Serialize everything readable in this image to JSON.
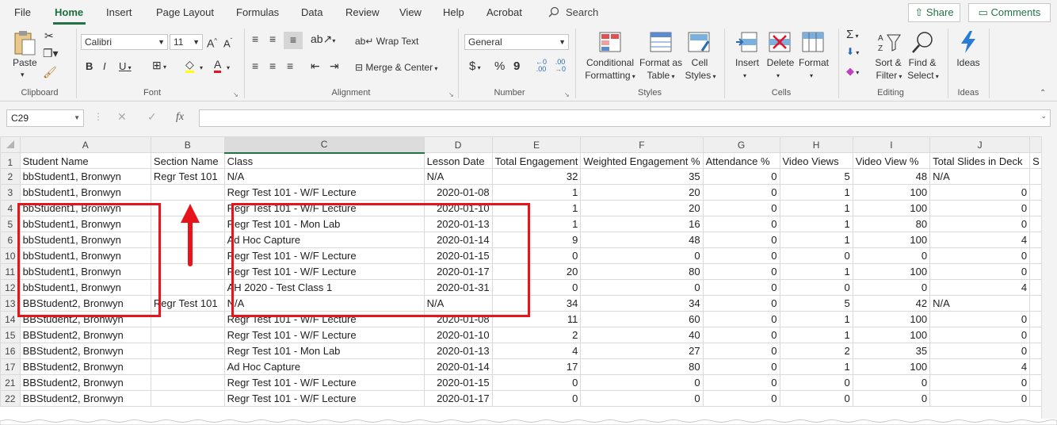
{
  "menu": {
    "tabs": [
      "File",
      "Home",
      "Insert",
      "Page Layout",
      "Formulas",
      "Data",
      "Review",
      "View",
      "Help",
      "Acrobat"
    ],
    "search": "Search",
    "share": "Share",
    "comments": "Comments"
  },
  "ribbon": {
    "clipboard": {
      "paste": "Paste",
      "label": "Clipboard"
    },
    "font": {
      "name": "Calibri",
      "size": "11",
      "label": "Font"
    },
    "alignment": {
      "wrap": "Wrap Text",
      "merge": "Merge & Center",
      "label": "Alignment"
    },
    "number": {
      "format": "General",
      "label": "Number"
    },
    "styles": {
      "cond1": "Conditional",
      "cond2": "Formatting",
      "fmt1": "Format as",
      "fmt2": "Table",
      "cell1": "Cell",
      "cell2": "Styles",
      "label": "Styles"
    },
    "cells": {
      "insert": "Insert",
      "delete": "Delete",
      "format": "Format",
      "label": "Cells"
    },
    "editing": {
      "sort1": "Sort &",
      "sort2": "Filter",
      "find1": "Find &",
      "find2": "Select",
      "label": "Editing"
    },
    "ideas": {
      "btn": "Ideas",
      "label": "Ideas"
    }
  },
  "formula_bar": {
    "name_box": "C29",
    "fx": "fx",
    "value": ""
  },
  "sheet": {
    "columns": [
      "A",
      "B",
      "C",
      "D",
      "E",
      "F",
      "G",
      "H",
      "I",
      "J",
      "S"
    ],
    "header_row": {
      "num": "1",
      "cells": [
        "Student Name",
        "Section Name",
        "Class",
        "Lesson Date",
        "Total Engagement",
        "Weighted Engagement %",
        "Attendance %",
        "Video Views",
        "Video View %",
        "Total Slides in Deck",
        "S"
      ]
    },
    "rows": [
      {
        "num": "2",
        "cells": [
          "bbStudent1, Bronwyn",
          "Regr Test 101",
          "N/A",
          "N/A",
          "32",
          "35",
          "0",
          "5",
          "48",
          "N/A"
        ]
      },
      {
        "num": "3",
        "cells": [
          "bbStudent1, Bronwyn",
          "",
          "Regr Test 101 - W/F Lecture",
          "2020-01-08",
          "1",
          "20",
          "0",
          "1",
          "100",
          "0"
        ]
      },
      {
        "num": "4",
        "cells": [
          "bbStudent1, Bronwyn",
          "",
          "Regr Test 101 - W/F Lecture",
          "2020-01-10",
          "1",
          "20",
          "0",
          "1",
          "100",
          "0"
        ]
      },
      {
        "num": "5",
        "cells": [
          "bbStudent1, Bronwyn",
          "",
          "Regr Test 101 - Mon Lab",
          "2020-01-13",
          "1",
          "16",
          "0",
          "1",
          "80",
          "0"
        ]
      },
      {
        "num": "6",
        "cells": [
          "bbStudent1, Bronwyn",
          "",
          "Ad Hoc Capture",
          "2020-01-14",
          "9",
          "48",
          "0",
          "1",
          "100",
          "4"
        ]
      },
      {
        "num": "10",
        "cells": [
          "bbStudent1, Bronwyn",
          "",
          "Regr Test 101 - W/F Lecture",
          "2020-01-15",
          "0",
          "0",
          "0",
          "0",
          "0",
          "0"
        ]
      },
      {
        "num": "11",
        "cells": [
          "bbStudent1, Bronwyn",
          "",
          "Regr Test 101 - W/F Lecture",
          "2020-01-17",
          "20",
          "80",
          "0",
          "1",
          "100",
          "0"
        ]
      },
      {
        "num": "12",
        "cells": [
          "bbStudent1, Bronwyn",
          "",
          "AH 2020 - Test Class 1",
          "2020-01-31",
          "0",
          "0",
          "0",
          "0",
          "0",
          "4"
        ]
      },
      {
        "num": "13",
        "cells": [
          "BBStudent2, Bronwyn",
          "Regr Test 101",
          "N/A",
          "N/A",
          "34",
          "34",
          "0",
          "5",
          "42",
          "N/A"
        ]
      },
      {
        "num": "14",
        "cells": [
          "BBStudent2, Bronwyn",
          "",
          "Regr Test 101 - W/F Lecture",
          "2020-01-08",
          "11",
          "60",
          "0",
          "1",
          "100",
          "0"
        ]
      },
      {
        "num": "15",
        "cells": [
          "BBStudent2, Bronwyn",
          "",
          "Regr Test 101 - W/F Lecture",
          "2020-01-10",
          "2",
          "40",
          "0",
          "1",
          "100",
          "0"
        ]
      },
      {
        "num": "16",
        "cells": [
          "BBStudent2, Bronwyn",
          "",
          "Regr Test 101 - Mon Lab",
          "2020-01-13",
          "4",
          "27",
          "0",
          "2",
          "35",
          "0"
        ]
      },
      {
        "num": "17",
        "cells": [
          "BBStudent2, Bronwyn",
          "",
          "Ad Hoc Capture",
          "2020-01-14",
          "17",
          "80",
          "0",
          "1",
          "100",
          "4"
        ]
      },
      {
        "num": "21",
        "cells": [
          "BBStudent2, Bronwyn",
          "",
          "Regr Test 101 - W/F Lecture",
          "2020-01-15",
          "0",
          "0",
          "0",
          "0",
          "0",
          "0"
        ]
      },
      {
        "num": "22",
        "cells": [
          "BBStudent2, Bronwyn",
          "",
          "Regr Test 101 - W/F Lecture",
          "2020-01-17",
          "0",
          "0",
          "0",
          "0",
          "0",
          "0"
        ]
      }
    ]
  },
  "colors": {
    "accent": "#217346",
    "highlight": "#e8141b"
  }
}
